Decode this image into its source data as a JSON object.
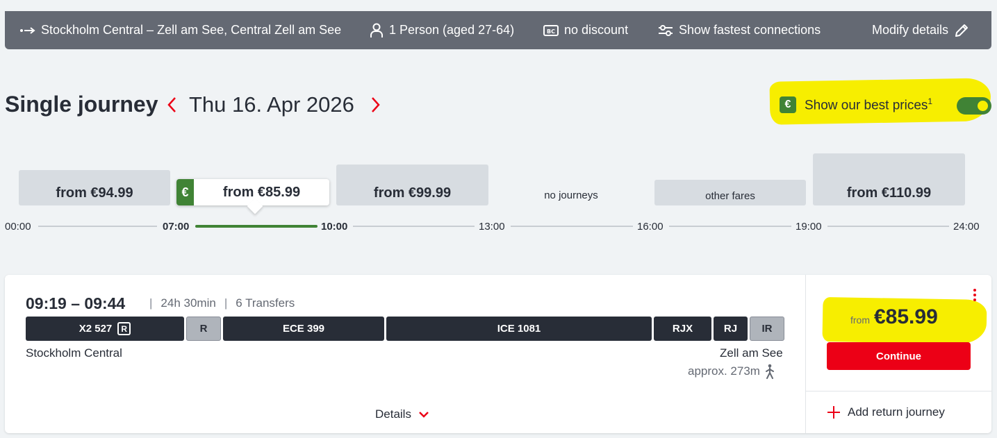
{
  "summary": {
    "route": "Stockholm Central – Zell am See, Central Zell am See",
    "passengers": "1 Person (aged 27-64)",
    "discount": "no discount",
    "filter": "Show fastest connections",
    "modify": "Modify details"
  },
  "header": {
    "title": "Single journey",
    "date": "Thu 16. Apr 2026",
    "best_prices_label": "Show our best prices",
    "best_prices_footnote": "1",
    "best_prices_on": true,
    "euro_symbol": "€"
  },
  "fares": {
    "slot1": "from €94.99",
    "slot2": "from €85.99",
    "slot3": "from €99.99",
    "slot4": "no journeys",
    "slot5": "other fares",
    "slot6": "from €110.99"
  },
  "axis": [
    "00:00",
    "07:00",
    "10:00",
    "13:00",
    "16:00",
    "19:00",
    "24:00"
  ],
  "connection": {
    "times": "09:19 – 09:44",
    "duration": "24h 30min",
    "transfers": "6 Transfers",
    "segments": [
      "X2 527",
      "R",
      "ECE 399",
      "ICE 1081",
      "RJX",
      "RJ",
      "IR"
    ],
    "reservation_badge": "R",
    "from": "Stockholm Central",
    "to": "Zell am See",
    "walk": "approx. 273m",
    "details": "Details",
    "price_from": "from",
    "price": "€85.99",
    "continue": "Continue",
    "add_return": "Add return journey"
  },
  "colors": {
    "accent_red": "#ec0016",
    "fare_green": "#408335",
    "bar_grey": "#646973",
    "highlight": "#f7ee00"
  }
}
